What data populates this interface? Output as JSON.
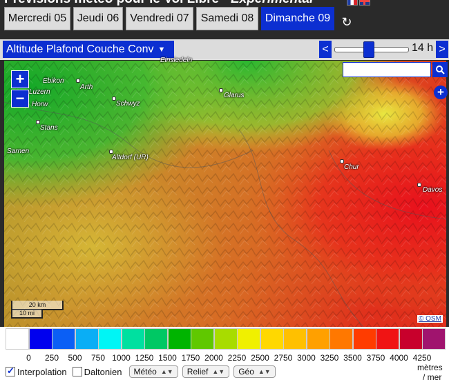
{
  "header": {
    "title_main": "Prévisions météo pour le Vol Libre - ",
    "title_em": "Expérimental"
  },
  "days": [
    {
      "label": "Mercredi 05",
      "active": false
    },
    {
      "label": "Jeudi 06",
      "active": false
    },
    {
      "label": "Vendredi 07",
      "active": false
    },
    {
      "label": "Samedi 08",
      "active": false
    },
    {
      "label": "Dimanche 09",
      "active": true
    }
  ],
  "toolbar": {
    "parameter": "Altitude Plafond Couche Conv",
    "prev": "<",
    "next": ">",
    "hour": "14 h",
    "hour_slider_fraction": 0.46
  },
  "map": {
    "zoom_in": "+",
    "zoom_out": "−",
    "search_placeholder": "",
    "layers": "+",
    "places": {
      "ebikon": "Ebikon",
      "luzern": "Luzern",
      "horw": "Horw",
      "arth": "Arth",
      "schwyz": "Schwyz",
      "glarus": "Glarus",
      "stans": "Stans",
      "sarnen": "Sarnen",
      "altdorf": "Altdorf (UR)",
      "chur": "Chur",
      "davos": "Davos",
      "einsiedeln": "Einsiedeln"
    },
    "scale_km": "20 km",
    "scale_mi": "10 mi",
    "attribution": "© OSM"
  },
  "legend": {
    "colors": [
      "#ffffff",
      "#0000ee",
      "#0b5ff5",
      "#0aaef5",
      "#00f5f5",
      "#00e0a0",
      "#00c864",
      "#00b400",
      "#60c800",
      "#a8dc00",
      "#f0f000",
      "#ffd800",
      "#ffc000",
      "#ffa000",
      "#ff7800",
      "#ff3c00",
      "#f01414",
      "#c8002c",
      "#a0146e"
    ],
    "ticks": [
      "0",
      "250",
      "500",
      "750",
      "1000",
      "1250",
      "1500",
      "1750",
      "2000",
      "2250",
      "2500",
      "2750",
      "3000",
      "3250",
      "3500",
      "3750",
      "4000",
      "4250"
    ],
    "unit_line1": "mètres",
    "unit_line2": "/ mer"
  },
  "controls": {
    "interpolation": "Interpolation",
    "interpolation_checked": true,
    "daltonien": "Daltonien",
    "daltonien_checked": false,
    "meteo": "Météo",
    "relief": "Relief",
    "geo": "Géo"
  }
}
